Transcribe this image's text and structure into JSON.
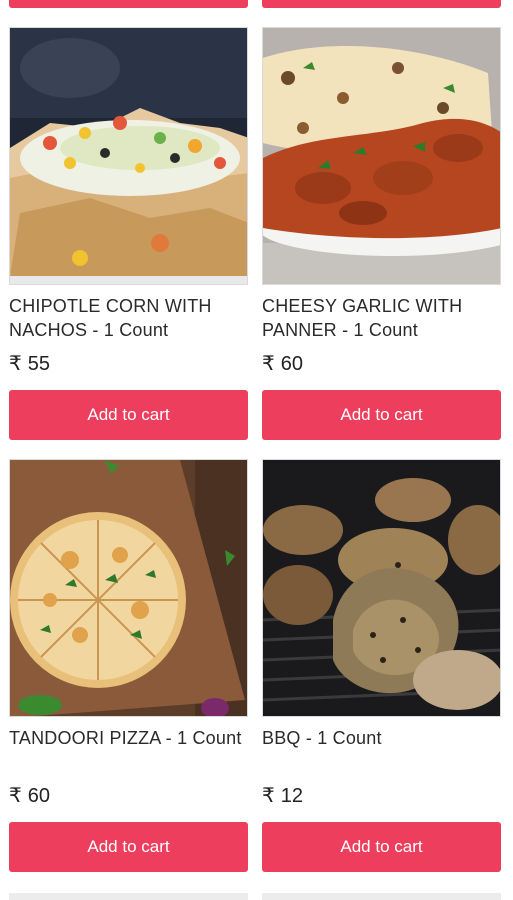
{
  "currency": "₹",
  "products": [
    {
      "title": "CHIPOTLE CORN WITH NACHOS - 1 Count",
      "price": "55",
      "button": "Add to cart",
      "image": "nachos-image"
    },
    {
      "title": "CHEESY GARLIC WITH PANNER - 1 Count",
      "price": "60",
      "button": "Add to cart",
      "image": "naan-curry-image"
    },
    {
      "title": "TANDOORI PIZZA - 1 Count",
      "price": "60",
      "button": "Add to cart",
      "image": "pizza-image"
    },
    {
      "title": "BBQ - 1 Count",
      "price": "12",
      "button": "Add to cart",
      "image": "bbq-wings-image"
    }
  ],
  "colors": {
    "accent": "#ee3e5d"
  }
}
